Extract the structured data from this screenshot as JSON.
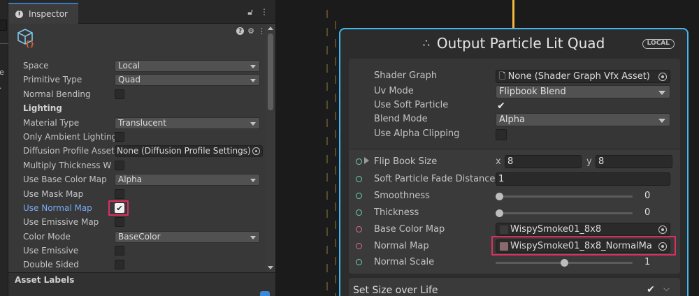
{
  "inspector": {
    "tab_label": "Inspector",
    "properties": [
      {
        "label": "Space",
        "type": "dropdown",
        "value": "Local"
      },
      {
        "label": "Primitive Type",
        "type": "dropdown",
        "value": "Quad"
      },
      {
        "label": "Normal Bending",
        "type": "checkbox",
        "checked": false
      },
      {
        "label": "Lighting",
        "type": "section"
      },
      {
        "label": "Material Type",
        "type": "dropdown",
        "value": "Translucent"
      },
      {
        "label": "Only Ambient Lighting",
        "type": "checkbox",
        "checked": false
      },
      {
        "label": "Diffusion Profile Asset",
        "type": "object",
        "value": "None (Diffusion Profile Settings)"
      },
      {
        "label": "Multiply Thickness W",
        "type": "checkbox",
        "checked": false
      },
      {
        "label": "Use Base Color Map",
        "type": "dropdown",
        "value": "Alpha"
      },
      {
        "label": "Use Mask Map",
        "type": "checkbox",
        "checked": false
      },
      {
        "label": "Use Normal Map",
        "type": "checkbox",
        "checked": true,
        "highlighted": true
      },
      {
        "label": "Use Emissive Map",
        "type": "checkbox",
        "checked": false
      },
      {
        "label": "Color Mode",
        "type": "dropdown",
        "value": "BaseColor"
      },
      {
        "label": "Use Emissive",
        "type": "checkbox",
        "checked": false
      },
      {
        "label": "Double Sided",
        "type": "checkbox",
        "checked": false
      }
    ],
    "asset_labels": "Asset Labels"
  },
  "node": {
    "title": "Output Particle Lit Quad",
    "badge": "LOCAL",
    "settings": {
      "shader_graph_label": "Shader Graph",
      "shader_graph_value": "None (Shader Graph Vfx Asset)",
      "uv_mode_label": "Uv Mode",
      "uv_mode_value": "Flipbook Blend",
      "use_soft_particle_label": "Use Soft Particle",
      "use_soft_particle_checked": true,
      "blend_mode_label": "Blend Mode",
      "blend_mode_value": "Alpha",
      "use_alpha_clipping_label": "Use Alpha Clipping",
      "use_alpha_clipping_checked": false
    },
    "slots": {
      "flip_book_label": "Flip Book Size",
      "flip_x_axis": "x",
      "flip_x": "8",
      "flip_y_axis": "y",
      "flip_y": "8",
      "soft_fade_label": "Soft Particle Fade Distance",
      "soft_fade_value": "1",
      "smoothness_label": "Smoothness",
      "smoothness_value": "0",
      "smoothness_fraction": 0,
      "thickness_label": "Thickness",
      "thickness_value": "0",
      "thickness_fraction": 0,
      "base_color_label": "Base Color Map",
      "base_color_value": "WispySmoke01_8x8",
      "normal_map_label": "Normal Map",
      "normal_map_value": "WispySmoke01_8x8_NormalMa",
      "normal_scale_label": "Normal Scale",
      "normal_scale_value": "1",
      "normal_scale_fraction": 0.5
    },
    "next_block_title": "Set Size over Life"
  },
  "colors": {
    "selection_outline": "#43b6ee",
    "flow_connection": "#f2b93a",
    "highlight_box": "#dc2f61",
    "highlight_label": "#7aa9f0"
  }
}
